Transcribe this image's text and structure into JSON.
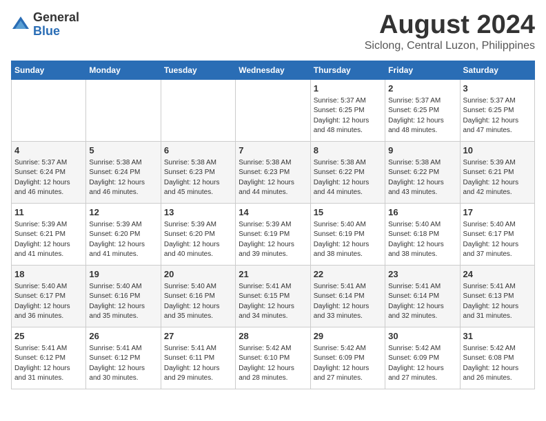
{
  "logo": {
    "general": "General",
    "blue": "Blue"
  },
  "header": {
    "title": "August 2024",
    "subtitle": "Siclong, Central Luzon, Philippines"
  },
  "days_of_week": [
    "Sunday",
    "Monday",
    "Tuesday",
    "Wednesday",
    "Thursday",
    "Friday",
    "Saturday"
  ],
  "weeks": [
    [
      {
        "day": "",
        "detail": ""
      },
      {
        "day": "",
        "detail": ""
      },
      {
        "day": "",
        "detail": ""
      },
      {
        "day": "",
        "detail": ""
      },
      {
        "day": "1",
        "detail": "Sunrise: 5:37 AM\nSunset: 6:25 PM\nDaylight: 12 hours\nand 48 minutes."
      },
      {
        "day": "2",
        "detail": "Sunrise: 5:37 AM\nSunset: 6:25 PM\nDaylight: 12 hours\nand 48 minutes."
      },
      {
        "day": "3",
        "detail": "Sunrise: 5:37 AM\nSunset: 6:25 PM\nDaylight: 12 hours\nand 47 minutes."
      }
    ],
    [
      {
        "day": "4",
        "detail": "Sunrise: 5:37 AM\nSunset: 6:24 PM\nDaylight: 12 hours\nand 46 minutes."
      },
      {
        "day": "5",
        "detail": "Sunrise: 5:38 AM\nSunset: 6:24 PM\nDaylight: 12 hours\nand 46 minutes."
      },
      {
        "day": "6",
        "detail": "Sunrise: 5:38 AM\nSunset: 6:23 PM\nDaylight: 12 hours\nand 45 minutes."
      },
      {
        "day": "7",
        "detail": "Sunrise: 5:38 AM\nSunset: 6:23 PM\nDaylight: 12 hours\nand 44 minutes."
      },
      {
        "day": "8",
        "detail": "Sunrise: 5:38 AM\nSunset: 6:22 PM\nDaylight: 12 hours\nand 44 minutes."
      },
      {
        "day": "9",
        "detail": "Sunrise: 5:38 AM\nSunset: 6:22 PM\nDaylight: 12 hours\nand 43 minutes."
      },
      {
        "day": "10",
        "detail": "Sunrise: 5:39 AM\nSunset: 6:21 PM\nDaylight: 12 hours\nand 42 minutes."
      }
    ],
    [
      {
        "day": "11",
        "detail": "Sunrise: 5:39 AM\nSunset: 6:21 PM\nDaylight: 12 hours\nand 41 minutes."
      },
      {
        "day": "12",
        "detail": "Sunrise: 5:39 AM\nSunset: 6:20 PM\nDaylight: 12 hours\nand 41 minutes."
      },
      {
        "day": "13",
        "detail": "Sunrise: 5:39 AM\nSunset: 6:20 PM\nDaylight: 12 hours\nand 40 minutes."
      },
      {
        "day": "14",
        "detail": "Sunrise: 5:39 AM\nSunset: 6:19 PM\nDaylight: 12 hours\nand 39 minutes."
      },
      {
        "day": "15",
        "detail": "Sunrise: 5:40 AM\nSunset: 6:19 PM\nDaylight: 12 hours\nand 38 minutes."
      },
      {
        "day": "16",
        "detail": "Sunrise: 5:40 AM\nSunset: 6:18 PM\nDaylight: 12 hours\nand 38 minutes."
      },
      {
        "day": "17",
        "detail": "Sunrise: 5:40 AM\nSunset: 6:17 PM\nDaylight: 12 hours\nand 37 minutes."
      }
    ],
    [
      {
        "day": "18",
        "detail": "Sunrise: 5:40 AM\nSunset: 6:17 PM\nDaylight: 12 hours\nand 36 minutes."
      },
      {
        "day": "19",
        "detail": "Sunrise: 5:40 AM\nSunset: 6:16 PM\nDaylight: 12 hours\nand 35 minutes."
      },
      {
        "day": "20",
        "detail": "Sunrise: 5:40 AM\nSunset: 6:16 PM\nDaylight: 12 hours\nand 35 minutes."
      },
      {
        "day": "21",
        "detail": "Sunrise: 5:41 AM\nSunset: 6:15 PM\nDaylight: 12 hours\nand 34 minutes."
      },
      {
        "day": "22",
        "detail": "Sunrise: 5:41 AM\nSunset: 6:14 PM\nDaylight: 12 hours\nand 33 minutes."
      },
      {
        "day": "23",
        "detail": "Sunrise: 5:41 AM\nSunset: 6:14 PM\nDaylight: 12 hours\nand 32 minutes."
      },
      {
        "day": "24",
        "detail": "Sunrise: 5:41 AM\nSunset: 6:13 PM\nDaylight: 12 hours\nand 31 minutes."
      }
    ],
    [
      {
        "day": "25",
        "detail": "Sunrise: 5:41 AM\nSunset: 6:12 PM\nDaylight: 12 hours\nand 31 minutes."
      },
      {
        "day": "26",
        "detail": "Sunrise: 5:41 AM\nSunset: 6:12 PM\nDaylight: 12 hours\nand 30 minutes."
      },
      {
        "day": "27",
        "detail": "Sunrise: 5:41 AM\nSunset: 6:11 PM\nDaylight: 12 hours\nand 29 minutes."
      },
      {
        "day": "28",
        "detail": "Sunrise: 5:42 AM\nSunset: 6:10 PM\nDaylight: 12 hours\nand 28 minutes."
      },
      {
        "day": "29",
        "detail": "Sunrise: 5:42 AM\nSunset: 6:09 PM\nDaylight: 12 hours\nand 27 minutes."
      },
      {
        "day": "30",
        "detail": "Sunrise: 5:42 AM\nSunset: 6:09 PM\nDaylight: 12 hours\nand 27 minutes."
      },
      {
        "day": "31",
        "detail": "Sunrise: 5:42 AM\nSunset: 6:08 PM\nDaylight: 12 hours\nand 26 minutes."
      }
    ]
  ]
}
